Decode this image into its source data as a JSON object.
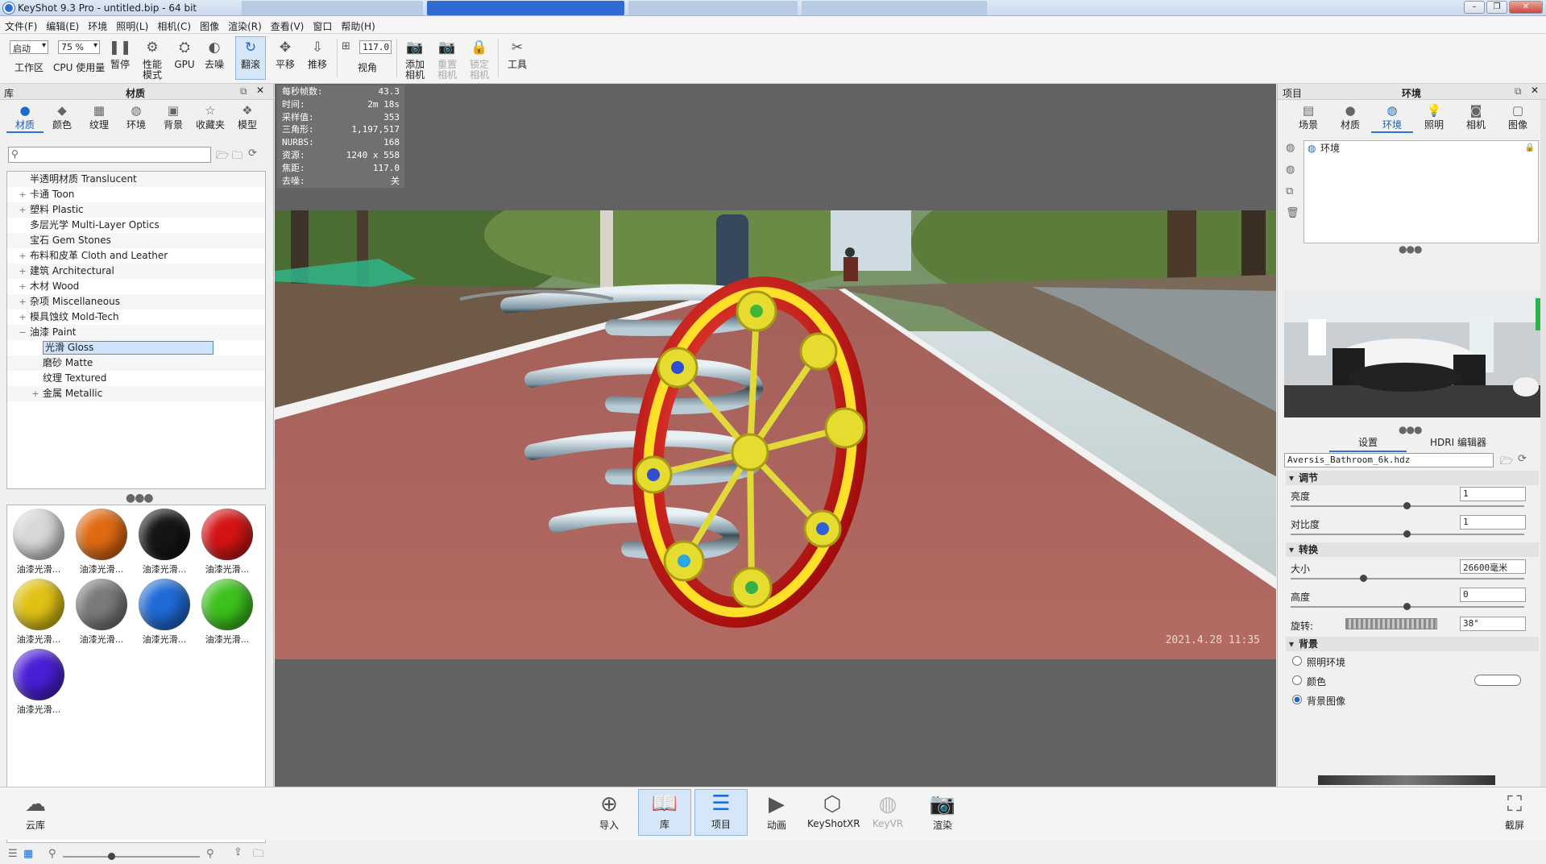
{
  "window": {
    "title": "KeyShot 9.3 Pro  - untitled.bip  - 64 bit"
  },
  "menu": [
    "文件(F)",
    "编辑(E)",
    "环境",
    "照明(L)",
    "相机(C)",
    "图像",
    "渲染(R)",
    "查看(V)",
    "窗口",
    "帮助(H)"
  ],
  "toolbar": {
    "workspace_value": "启动",
    "workspace_label": "工作区",
    "cpu_value": "75 %",
    "cpu_label": "CPU 使用量",
    "pause": "暂停",
    "perf_mode": "性能模式",
    "gpu": "GPU",
    "denoise": "去噪",
    "tumble": "翻滚",
    "pan": "平移",
    "dolly": "推移",
    "fov_value": "117.0",
    "fov_label": "视角",
    "add_camera": "添加相机",
    "reset_camera": "重置相机",
    "lock_camera": "锁定相机",
    "tools": "工具"
  },
  "library": {
    "title": "库",
    "header": "材质",
    "tabs": [
      "材质",
      "颜色",
      "纹理",
      "环境",
      "背景",
      "收藏夹",
      "模型"
    ],
    "tree": [
      {
        "label": "半透明材质 Translucent",
        "expand": "",
        "indent": 0
      },
      {
        "label": "卡通 Toon",
        "expand": "+",
        "indent": 0
      },
      {
        "label": "塑料 Plastic",
        "expand": "+",
        "indent": 0
      },
      {
        "label": "多层光学 Multi-Layer Optics",
        "expand": "",
        "indent": 0
      },
      {
        "label": "宝石 Gem Stones",
        "expand": "",
        "indent": 0
      },
      {
        "label": "布料和皮革 Cloth and Leather",
        "expand": "+",
        "indent": 0
      },
      {
        "label": "建筑 Architectural",
        "expand": "+",
        "indent": 0
      },
      {
        "label": "木材 Wood",
        "expand": "+",
        "indent": 0
      },
      {
        "label": "杂项 Miscellaneous",
        "expand": "+",
        "indent": 0
      },
      {
        "label": "模具蚀纹 Mold-Tech",
        "expand": "+",
        "indent": 0
      },
      {
        "label": "油漆 Paint",
        "expand": "−",
        "indent": 0
      },
      {
        "label": "光滑 Gloss",
        "expand": "",
        "indent": 1,
        "selected": true
      },
      {
        "label": "磨砂 Matte",
        "expand": "",
        "indent": 1
      },
      {
        "label": "纹理 Textured",
        "expand": "",
        "indent": 1
      },
      {
        "label": "金属 Metallic",
        "expand": "+",
        "indent": 1
      }
    ],
    "thumbnails": [
      {
        "label": "油漆光滑...",
        "color": "#d8d8d8"
      },
      {
        "label": "油漆光滑...",
        "color": "#e06a12"
      },
      {
        "label": "油漆光滑...",
        "color": "#151515"
      },
      {
        "label": "油漆光滑...",
        "color": "#d41414"
      },
      {
        "label": "油漆光滑...",
        "color": "#e0c214"
      },
      {
        "label": "油漆光滑...",
        "color": "#7a7a7a"
      },
      {
        "label": "油漆光滑...",
        "color": "#1f6ad6"
      },
      {
        "label": "油漆光滑...",
        "color": "#3cc21c"
      },
      {
        "label": "油漆光滑...",
        "color": "#4a1fd6"
      }
    ]
  },
  "stats": [
    {
      "k": "每秒帧数:",
      "v": "43.3"
    },
    {
      "k": "时间:",
      "v": "2m 18s"
    },
    {
      "k": "采样值:",
      "v": "353"
    },
    {
      "k": "三角形:",
      "v": "1,197,517"
    },
    {
      "k": "NURBS:",
      "v": "168"
    },
    {
      "k": "资源:",
      "v": "1240 x 558"
    },
    {
      "k": "焦距:",
      "v": "117.0"
    },
    {
      "k": "去噪:",
      "v": "关"
    }
  ],
  "scene": {
    "timestamp": "2021.4.28 11:35"
  },
  "project": {
    "title": "项目",
    "header": "环境",
    "tabs": [
      "场景",
      "材质",
      "环境",
      "照明",
      "相机",
      "图像"
    ],
    "env_item": "环境",
    "subtabs": [
      "设置",
      "HDRI 编辑器"
    ],
    "hdri_file": "Aversis_Bathroom_6k.hdz",
    "sections": {
      "adjust": "调节",
      "transform": "转换",
      "background": "背景"
    },
    "brightness_label": "亮度",
    "brightness_value": "1",
    "contrast_label": "对比度",
    "contrast_value": "1",
    "size_label": "大小",
    "size_value": "26600毫米",
    "height_label": "高度",
    "height_value": "0",
    "rotation_label": "旋转:",
    "rotation_value": "38°",
    "bg_options": [
      "照明环境",
      "颜色",
      "背景图像"
    ]
  },
  "bottom": {
    "cloud": "云库",
    "import": "导入",
    "library": "库",
    "project": "项目",
    "animation": "动画",
    "keyshotxr": "KeyShotXR",
    "keyvr": "KeyVR",
    "render": "渲染",
    "screenshot": "截屏"
  }
}
